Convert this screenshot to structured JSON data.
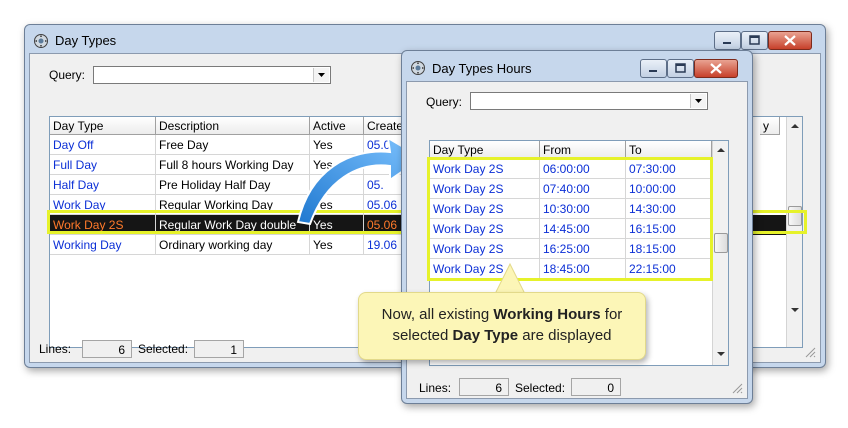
{
  "main_window": {
    "title": "Day Types",
    "query_label": "Query:",
    "query_value": "",
    "columns": [
      "Day Type",
      "Description",
      "Active",
      "Create",
      "y"
    ],
    "rows": [
      {
        "day_type": "Day Off",
        "description": "Free Day",
        "active": "Yes",
        "created": "05.0"
      },
      {
        "day_type": "Full Day",
        "description": "Full 8 hours Working Day",
        "active": "Yes",
        "created": ""
      },
      {
        "day_type": "Half Day",
        "description": "Pre Holiday Half Day",
        "active": "",
        "created": "05."
      },
      {
        "day_type": "Work Day",
        "description": "Regular Working Day",
        "active": "Yes",
        "created": "05.06"
      },
      {
        "day_type": "Work Day 2S",
        "description": "Regular Work Day double",
        "active": "Yes",
        "created": "05.06"
      },
      {
        "day_type": "Working Day",
        "description": "Ordinary working day",
        "active": "Yes",
        "created": "19.06"
      }
    ],
    "selected_row_index": 4,
    "status": {
      "lines_label": "Lines:",
      "lines_value": "6",
      "selected_label": "Selected:",
      "selected_value": "1"
    }
  },
  "hours_window": {
    "title": "Day Types Hours",
    "query_label": "Query:",
    "query_value": "",
    "columns": [
      "Day Type",
      "From",
      "To"
    ],
    "rows": [
      {
        "day_type": "Work Day 2S",
        "from": "06:00:00",
        "to": "07:30:00"
      },
      {
        "day_type": "Work Day 2S",
        "from": "07:40:00",
        "to": "10:00:00"
      },
      {
        "day_type": "Work Day 2S",
        "from": "10:30:00",
        "to": "14:30:00"
      },
      {
        "day_type": "Work Day 2S",
        "from": "14:45:00",
        "to": "16:15:00"
      },
      {
        "day_type": "Work Day 2S",
        "from": "16:25:00",
        "to": "18:15:00"
      },
      {
        "day_type": "Work Day 2S",
        "from": "18:45:00",
        "to": "22:15:00"
      }
    ],
    "status": {
      "lines_label": "Lines:",
      "lines_value": "6",
      "selected_label": "Selected:",
      "selected_value": "0"
    }
  },
  "callout": {
    "part1": "Now, all existing ",
    "bold1": "Working Hours",
    "part2": " for selected ",
    "bold2": "Day Type",
    "part3": " are displayed"
  },
  "colors": {
    "highlight": "#e6f22a",
    "link_text": "#0b2fd6",
    "selected_row": "#151515",
    "arrow": "#2f8fe0"
  },
  "icons": [
    "app-icon",
    "minimize-icon",
    "maximize-icon",
    "close-icon",
    "dropdown-arrow-icon",
    "scroll-up-icon",
    "scroll-down-icon",
    "resize-grip-icon",
    "callout-arrow-icon"
  ]
}
